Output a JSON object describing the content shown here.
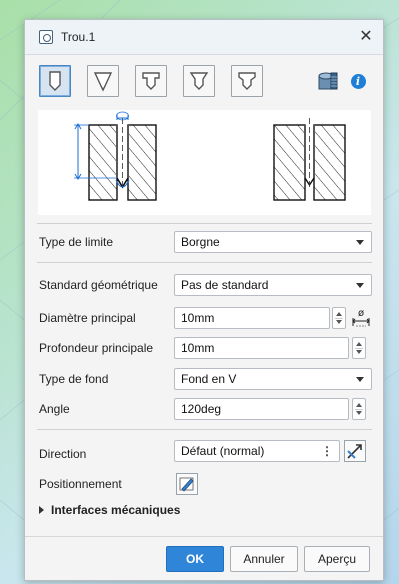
{
  "window": {
    "title": "Trou.1"
  },
  "hole_types": [
    {
      "name": "simple",
      "active": true
    },
    {
      "name": "tapered",
      "active": false
    },
    {
      "name": "counterbored",
      "active": false
    },
    {
      "name": "countersunk",
      "active": false
    },
    {
      "name": "counterdrilled",
      "active": false
    }
  ],
  "icons": {
    "close": "close-icon",
    "threaded_hole": "threaded-hole-icon",
    "info": "info-icon",
    "diameter": "diameter-icon",
    "direction": "direction-icon",
    "positioning": "sketch-icon"
  },
  "fields": {
    "limit_type": {
      "label": "Type de limite",
      "value": "Borgne"
    },
    "geometric_standard": {
      "label": "Standard géométrique",
      "value": "Pas de standard"
    },
    "main_diameter": {
      "label": "Diamètre principal",
      "value": "10mm"
    },
    "main_depth": {
      "label": "Profondeur principale",
      "value": "10mm"
    },
    "bottom_type": {
      "label": "Type de fond",
      "value": "Fond en V"
    },
    "angle": {
      "label": "Angle",
      "value": "120deg"
    },
    "direction": {
      "label": "Direction",
      "value": "Défaut (normal)"
    },
    "positioning": {
      "label": "Positionnement"
    }
  },
  "sections": {
    "mechanical_interfaces": "Interfaces mécaniques"
  },
  "buttons": {
    "ok": "OK",
    "cancel": "Annuler",
    "preview": "Aperçu"
  },
  "info_glyph": "i",
  "close_glyph": "✕",
  "colors": {
    "accent": "#2f86d9",
    "preview_dim": "#1a6fd4",
    "background": "#f4f4f4"
  }
}
